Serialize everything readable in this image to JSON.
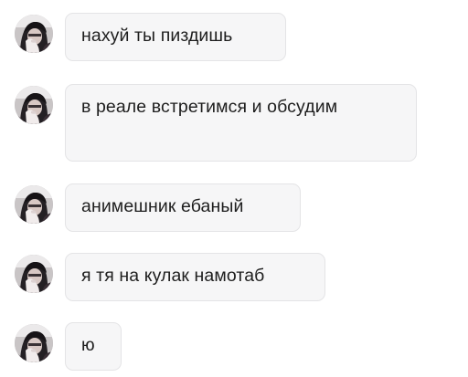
{
  "chat": {
    "messages": [
      {
        "text": "нахуй ты пиздишь"
      },
      {
        "text": "в реале встретимся и обсудим"
      },
      {
        "text": "анимешник ебаный"
      },
      {
        "text": "я тя на кулак намотаб"
      },
      {
        "text": "ю"
      }
    ]
  },
  "colors": {
    "bubble_background": "#f6f6f7",
    "bubble_border": "#e4e4e6",
    "text": "#1e1e1e",
    "page_background": "#ffffff"
  },
  "icons": {
    "avatar": "user-avatar-photo"
  }
}
